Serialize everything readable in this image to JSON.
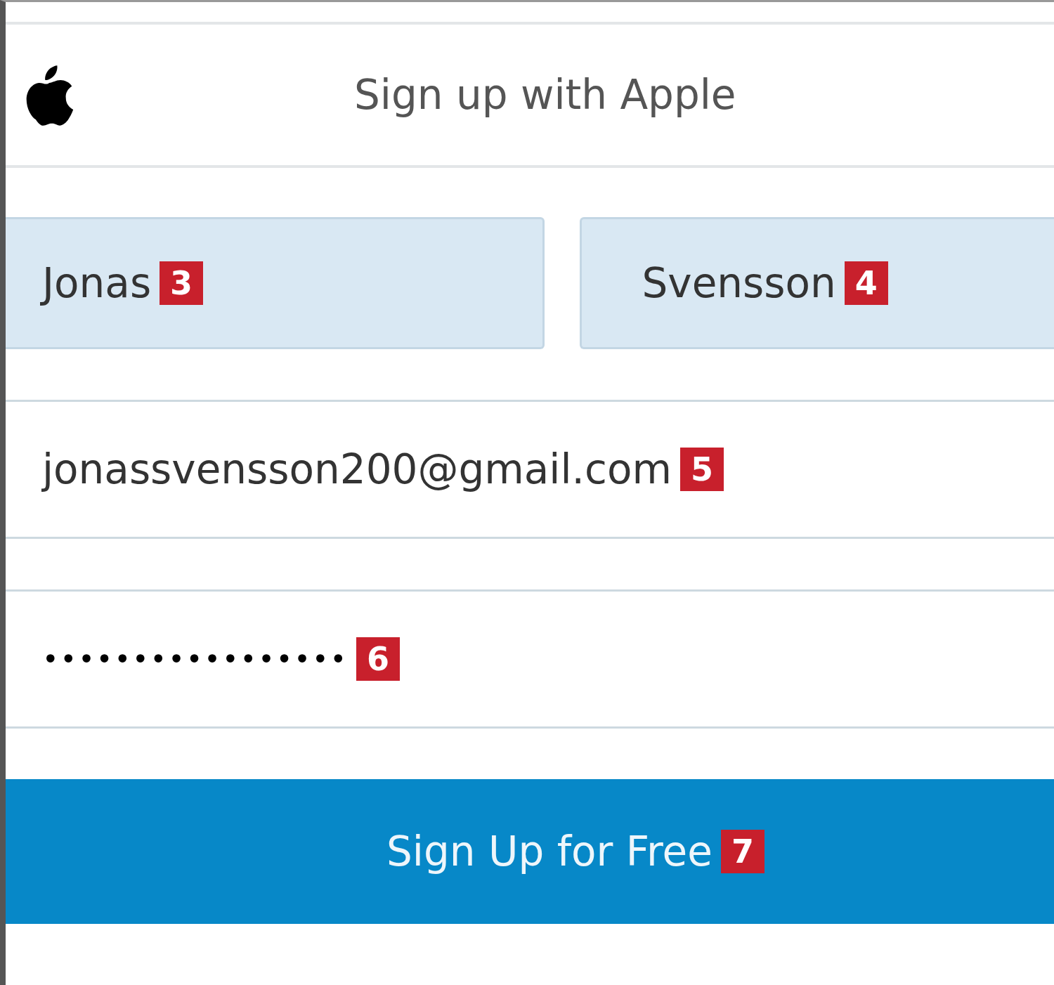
{
  "apple_button": {
    "label": "Sign up with Apple"
  },
  "fields": [
    {
      "kind": "name",
      "value": "Jonas",
      "marker": "3"
    },
    {
      "kind": "name",
      "value": "Svensson",
      "marker": "4"
    },
    {
      "kind": "email",
      "value": "jonassvensson200@gmail.com",
      "marker": "5"
    },
    {
      "kind": "password",
      "value": "•••••••••••••••••",
      "marker": "6"
    }
  ],
  "submit_button": {
    "label": "Sign Up for Free",
    "marker": "7"
  }
}
